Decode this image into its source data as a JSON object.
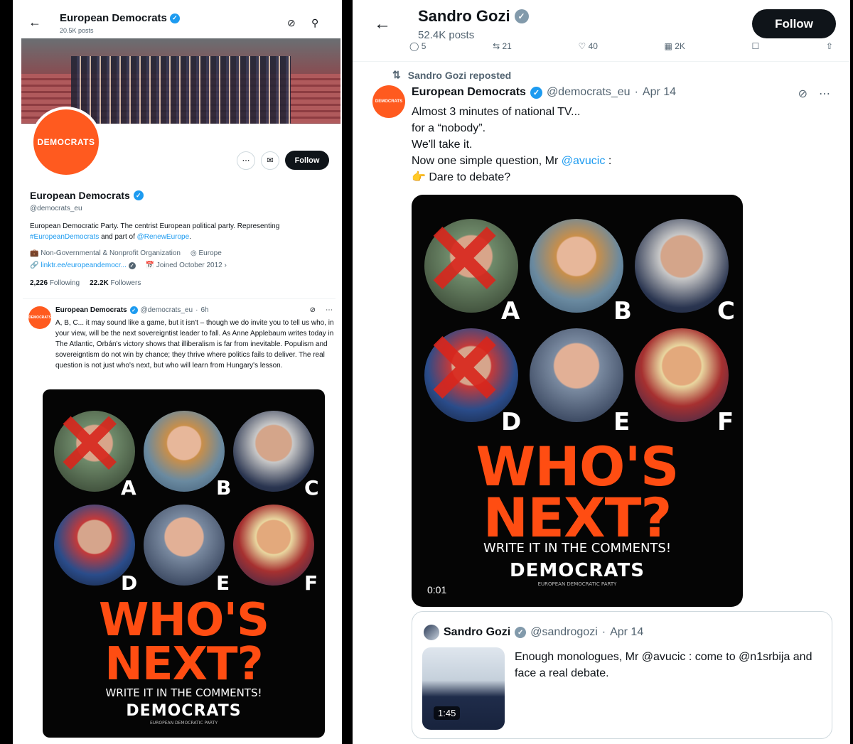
{
  "left": {
    "header": {
      "title": "European Democrats",
      "posts": "20.5K posts"
    },
    "profile": {
      "avatar_text": "DEMOCRATS",
      "follow_label": "Follow",
      "name": "European Democrats",
      "handle": "@democrats_eu",
      "bio_part1": "European Democratic Party. The centrist European political party. Representing",
      "bio_hashtag": "#EuropeanDemocrats",
      "bio_part2": "and part of",
      "bio_mention": "@RenewEurope",
      "bio_end": ".",
      "category": "Non-Governmental & Nonprofit Organization",
      "location": "Europe",
      "link": "linktr.ee/europeandemocr...",
      "joined": "Joined October 2012",
      "following_count": "2,226",
      "following_label": "Following",
      "followers_count": "22.2K",
      "followers_label": "Followers"
    },
    "tweet": {
      "avatar_text": "DEMOCRATS",
      "name": "European Democrats",
      "handle": "@democrats_eu",
      "time": "6h",
      "text": "A, B, C... it may sound like a game, but it isn't – though we do invite you to tell us who, in your view, will be the next sovereigntist leader to fall. As Anne Applebaum writes today in The Atlantic, Orbán's victory shows that illiberalism is far from inevitable. Populism and sovereigntism do not win by chance; they thrive where politics fails to deliver. The real question is not just who's next, but who will learn from Hungary's lesson."
    }
  },
  "poster": {
    "letters": [
      "A",
      "B",
      "C",
      "D",
      "E",
      "F"
    ],
    "headline1": "WHO'S",
    "headline2": "NEXT?",
    "cta": "WRITE IT IN THE COMMENTS!",
    "brand": "DEMOCRATS",
    "brand_sub": "EUROPEAN DEMOCRATIC PARTY"
  },
  "right": {
    "header": {
      "title": "Sandro Gozi",
      "posts": "52.4K posts",
      "follow_label": "Follow"
    },
    "action_strip": [
      "5",
      "21",
      "40",
      "2K"
    ],
    "repost_label": "Sandro Gozi reposted",
    "tweet": {
      "avatar_text": "DEMOCRATS",
      "name": "European Democrats",
      "handle": "@democrats_eu",
      "time": "Apr 14",
      "line1": "Almost 3 minutes of national TV...",
      "line2": "for a “nobody”.",
      "line3": "We'll take it.",
      "line4_pre": "Now one simple question, Mr",
      "line4_mention": "@avucic",
      "line4_post": ":",
      "line5_emoji": "👉",
      "line5_text": "Dare to debate?",
      "video_time": "0:01"
    },
    "quote": {
      "name": "Sandro Gozi",
      "handle": "@sandrogozi",
      "time": "Apr 14",
      "text": "Enough monologues, Mr @avucic : come to @n1srbija and face a real debate.",
      "duration": "1:45"
    }
  },
  "colors": {
    "accent": "#1d9bf0",
    "brand_orange": "#ff5a1f",
    "cross_red": "#d9261c"
  }
}
